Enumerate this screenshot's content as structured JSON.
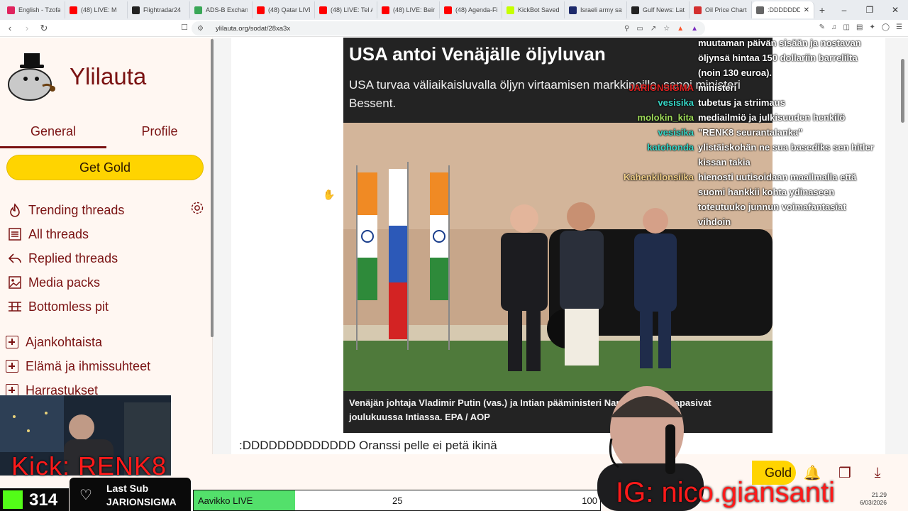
{
  "browser": {
    "tabs": [
      {
        "label": "English - Tzofa",
        "color": "#e0245e"
      },
      {
        "label": "(48) LIVE: M",
        "color": "#ff0000"
      },
      {
        "label": "Flightradar24",
        "color": "#222222"
      },
      {
        "label": "ADS-B Exchang",
        "color": "#3aa757"
      },
      {
        "label": "(48) Qatar LIVE",
        "color": "#ff0000"
      },
      {
        "label": "(48) LIVE: Tel Av",
        "color": "#ff0000"
      },
      {
        "label": "(48) LIVE: Beiru",
        "color": "#ff0000"
      },
      {
        "label": "(48) Agenda-Fi",
        "color": "#ff0000"
      },
      {
        "label": "KickBot Saved",
        "color": "#c6ff00"
      },
      {
        "label": "Israeli army say",
        "color": "#1d2a6b"
      },
      {
        "label": "Gulf News: Lat",
        "color": "#222222"
      },
      {
        "label": "Oil Price Charts",
        "color": "#d32f2f"
      },
      {
        "label": ":DDDDDDD",
        "color": "#666666"
      }
    ],
    "url": "ylilauta.org/sodat/28xa3x"
  },
  "sidebar": {
    "brand": "Ylilauta",
    "tabs": [
      "General",
      "Profile"
    ],
    "gold_button": "Get Gold",
    "nav": [
      "Trending threads",
      "All threads",
      "Replied threads",
      "Media packs",
      "Bottomless pit"
    ],
    "categories": [
      "Ajankohtaista",
      "Elämä ja ihmissuhteet",
      "Harrastukset"
    ]
  },
  "news_image": {
    "headline": "USA antoi Venäjälle öljyluvan",
    "subhead": "USA turvaa väliaikaisluvalla öljyn virtaamisen markkinoille, sanoi ministeri Bessent.",
    "caption": "Venäjän johtaja Vladimir Putin (vas.) ja Intian pääministeri Narendra Modi tapasivat joulukuussa Intiassa. EPA / AOP"
  },
  "chat": [
    {
      "name": "",
      "text": "muutaman päivän sisään ja nostavan",
      "color": "#ffffff"
    },
    {
      "name": "",
      "text": "öljynsä hintaa 150 dollariin barrelilta",
      "color": "#ffffff"
    },
    {
      "name": "",
      "text": "(noin 130 euroa).",
      "color": "#ffffff"
    },
    {
      "name": "JARIONSIGMA",
      "text": "ministeri",
      "color": "#e02020"
    },
    {
      "name": "vesisika",
      "text": "tubetus ja striimaus",
      "color": "#36d6c6"
    },
    {
      "name": "molokin_kita",
      "text": "mediailmiö ja julkisuuden henkilö",
      "color": "#9fdc5a"
    },
    {
      "name": "vesisika",
      "text": "\"RENK8 seurantalanka\"",
      "color": "#36d6c6"
    },
    {
      "name": "katohonda",
      "text": "ylistäiskohän ne sua basediks sen hitler",
      "color": "#36d6c6"
    },
    {
      "name": "",
      "text": "kissan takia",
      "color": "#ffffff"
    },
    {
      "name": "Kahenkilonsiika",
      "text": "hienosti uutisoidaan maailmalla että",
      "color": "#f2d08a"
    },
    {
      "name": "",
      "text": "suomi hankkii kohta ydinaseen",
      "color": "#ffffff"
    },
    {
      "name": "",
      "text": "toteutuuko junnun voimafantasiat",
      "color": "#ffffff"
    },
    {
      "name": "",
      "text": "vihdoin",
      "color": "#ffffff"
    }
  ],
  "post_text": ":DDDDDDDDDDDDD Oranssi pelle ei petä ikinä",
  "stream": {
    "kick_label": "Kick: RENK8",
    "followers": "314",
    "last_sub_label": "Last Sub",
    "last_sub_name": "JARIONSIGMA",
    "goal_label": "Aavikko LIVE",
    "goal_current": "25",
    "goal_max": "100",
    "goal_fraction": 0.25,
    "ig_label": "IG: nico.giansanti"
  },
  "footer_gold": "Gold",
  "clock": {
    "time": "21.29",
    "date": "6/03/2026"
  }
}
